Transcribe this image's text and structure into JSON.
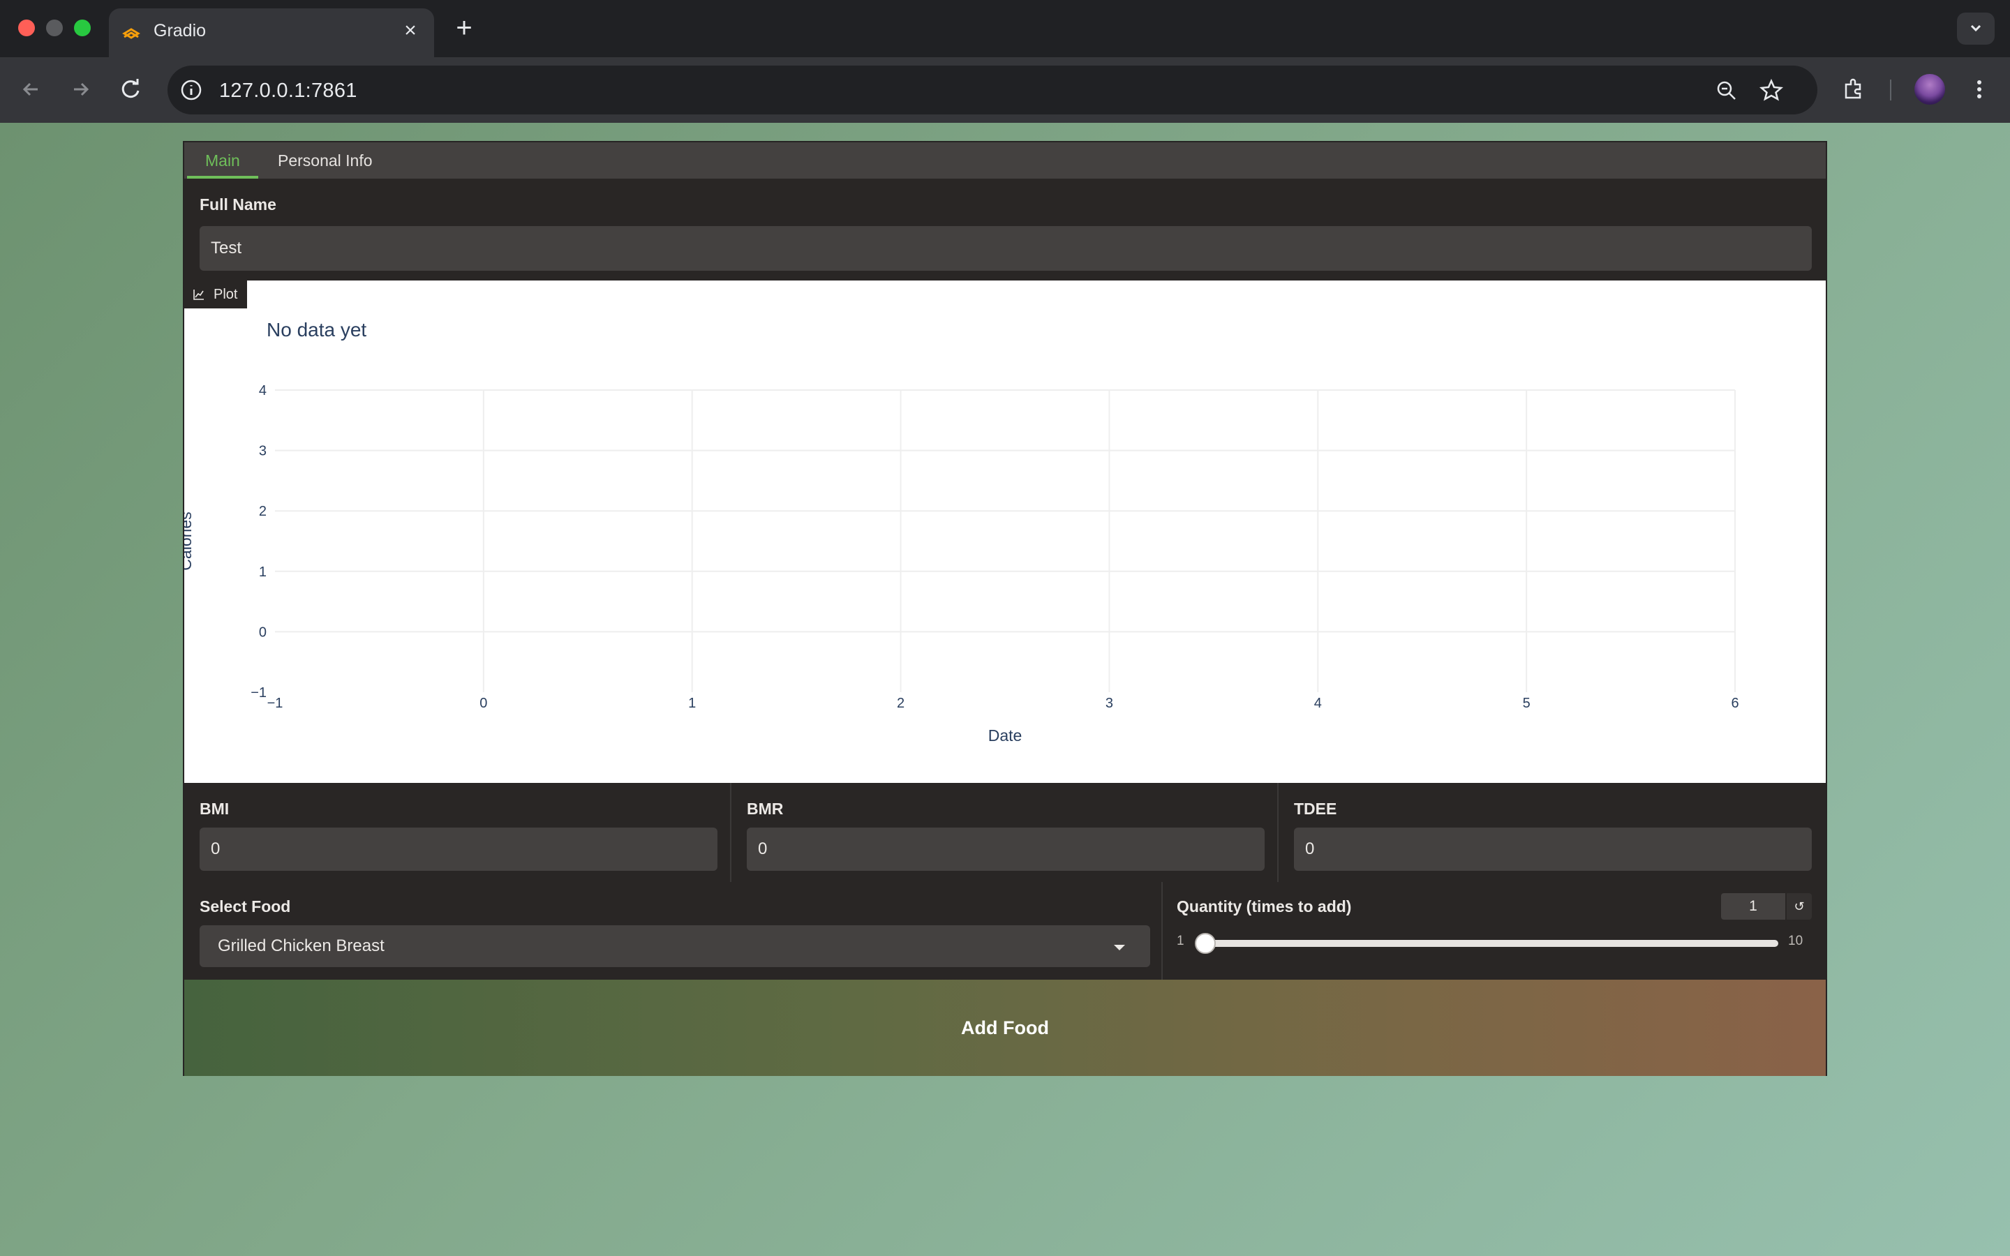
{
  "browser": {
    "tab_title": "Gradio",
    "url": "127.0.0.1:7861"
  },
  "app": {
    "tabs": [
      {
        "label": "Main",
        "active": true
      },
      {
        "label": "Personal Info",
        "active": false
      }
    ],
    "full_name": {
      "label": "Full Name",
      "value": "Test"
    },
    "plot": {
      "badge_label": "Plot",
      "icon": "chart-icon"
    },
    "metrics": [
      {
        "label": "BMI",
        "value": "0"
      },
      {
        "label": "BMR",
        "value": "0"
      },
      {
        "label": "TDEE",
        "value": "0"
      }
    ],
    "food": {
      "label": "Select Food",
      "value": "Grilled Chicken Breast"
    },
    "quantity": {
      "label": "Quantity (times to add)",
      "value": "1",
      "min": "1",
      "max": "10",
      "reset_icon": "↺"
    },
    "add_button": "Add Food"
  },
  "chart_data": {
    "type": "line",
    "title": "No data yet",
    "xlabel": "Date",
    "ylabel": "Calories",
    "x_ticks": [
      "−1",
      "0",
      "1",
      "2",
      "3",
      "4",
      "5",
      "6"
    ],
    "y_ticks": [
      "−1",
      "0",
      "1",
      "2",
      "3",
      "4"
    ],
    "xlim": [
      -1,
      6
    ],
    "ylim": [
      -1,
      4
    ],
    "series": [],
    "grid": true,
    "colors": {
      "grid": "#eeeeee",
      "text": "#2a3f5f"
    }
  }
}
